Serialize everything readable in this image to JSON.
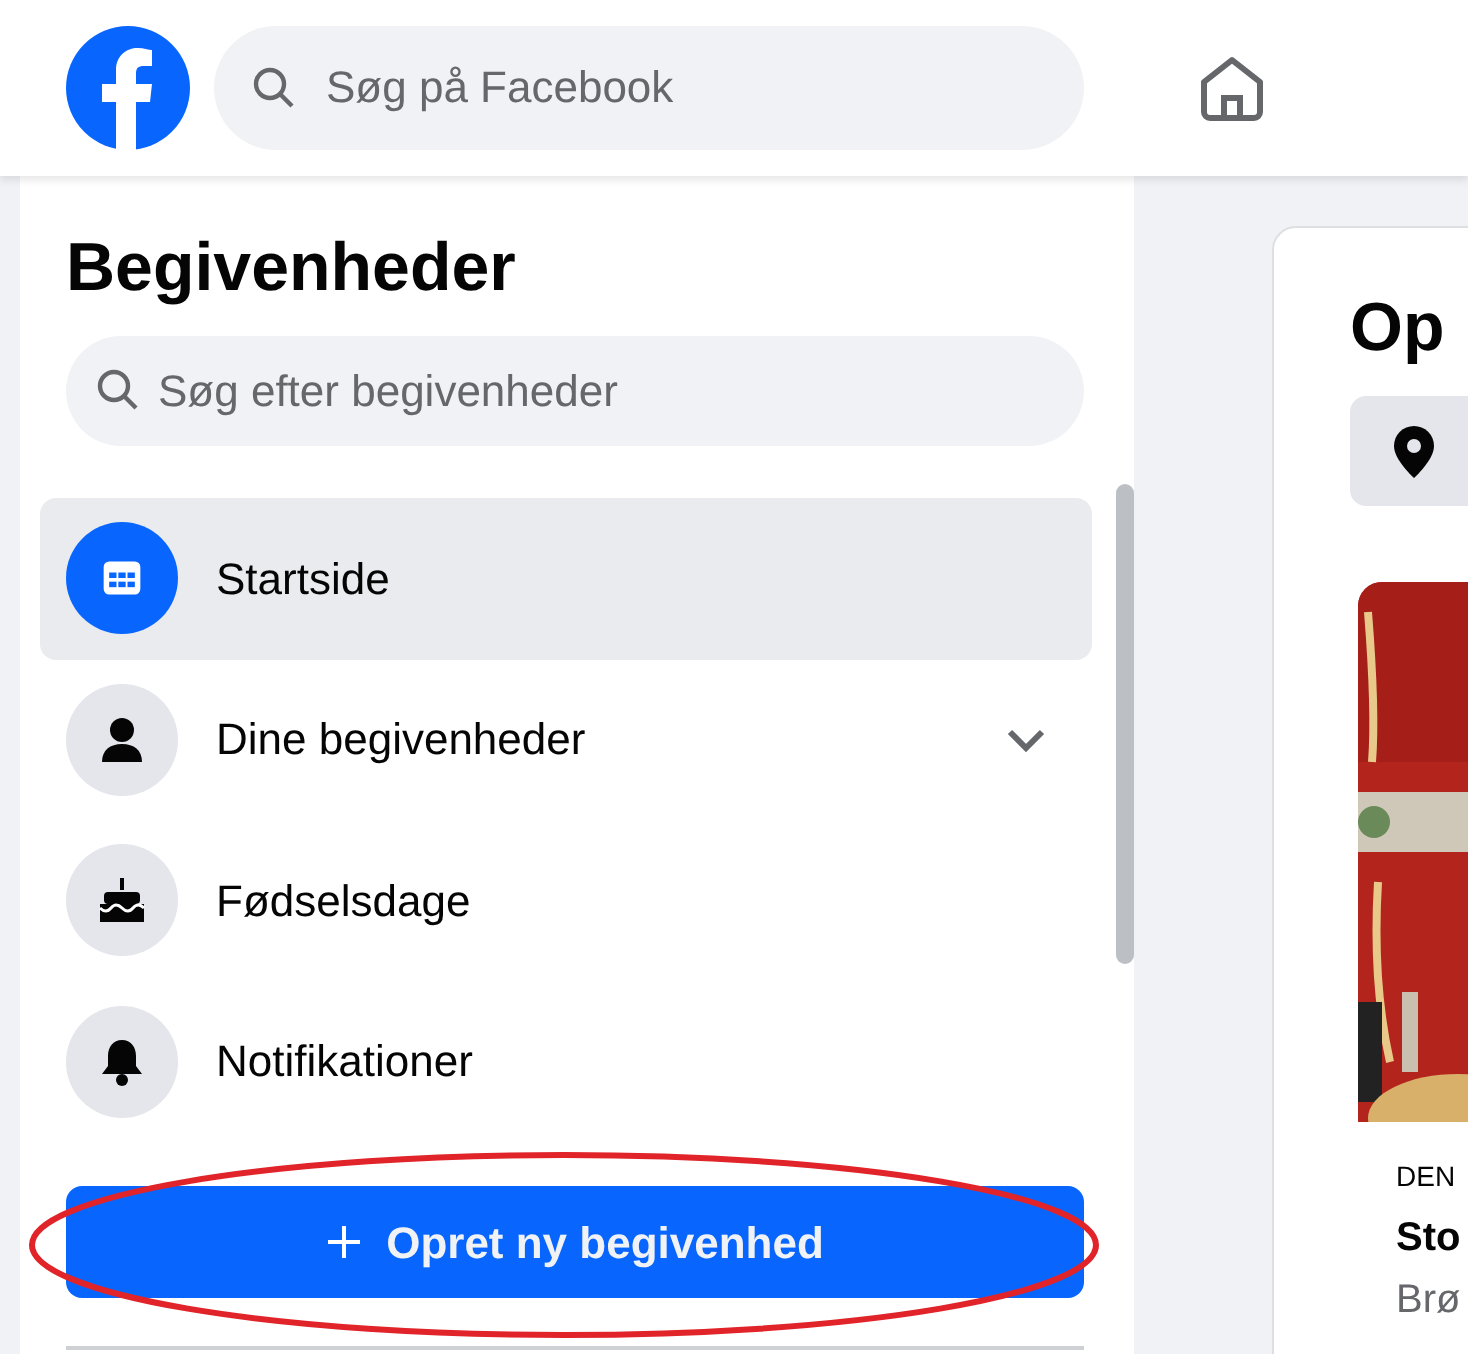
{
  "header": {
    "search": {
      "placeholder": "Søg på Facebook"
    }
  },
  "sidebar": {
    "title": "Begivenheder",
    "search": {
      "placeholder": "Søg efter begivenheder"
    },
    "items": [
      {
        "label": "Startside",
        "kind": "calendar",
        "selected": true,
        "expandable": false
      },
      {
        "label": "Dine begivenheder",
        "kind": "person",
        "selected": false,
        "expandable": true
      },
      {
        "label": "Fødselsdage",
        "kind": "cake",
        "selected": false,
        "expandable": false
      },
      {
        "label": "Notifikationer",
        "kind": "bell",
        "selected": false,
        "expandable": false
      }
    ],
    "create_button": "Opret ny begivenhed",
    "annotated": true
  },
  "main": {
    "title": "Op",
    "event": {
      "date": "DEN",
      "name": "Sto",
      "place": "Brø"
    }
  }
}
